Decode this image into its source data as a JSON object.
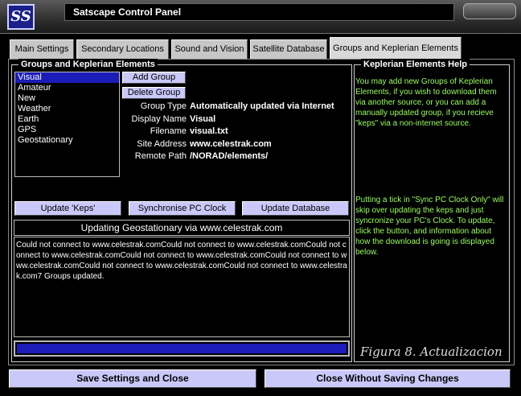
{
  "window": {
    "title": "Satscape Control Panel",
    "logo_text": "SS"
  },
  "tabs": [
    {
      "label": "Main Settings"
    },
    {
      "label": "Secondary Locations"
    },
    {
      "label": "Sound and Vision"
    },
    {
      "label": "Satellite Database"
    },
    {
      "label": "Groups and Keplerian Elements"
    }
  ],
  "groups_panel": {
    "legend": "Groups and Keplerian Elements",
    "list": [
      "Visual",
      "Amateur",
      "New",
      "Weather",
      "Earth",
      "GPS",
      "Geostationary"
    ],
    "selected": "Visual",
    "add_button": "Add Group",
    "delete_button": "Delete Group",
    "fields": [
      {
        "label": "Group Type",
        "value": "Automatically updated via Internet"
      },
      {
        "label": "Display Name",
        "value": "Visual"
      },
      {
        "label": "Filename",
        "value": "visual.txt"
      },
      {
        "label": "Site Address",
        "value": "www.celestrak.com"
      },
      {
        "label": "Remote Path",
        "value": "/NORAD/elements/"
      }
    ],
    "update_keps_button": "Update 'Keps'",
    "sync_clock_button": "Synchronise PC Clock",
    "update_db_button": "Update Database",
    "status_title": "Updating Geostationary via www.celestrak.com",
    "log_text": "Could not connect to www.celestrak.comCould not connect to www.celestrak.comCould not connect to www.celestrak.comCould not connect to www.celestrak.comCould not connect to www.celestrak.comCould not connect to www.celestrak.comCould not connect to www.celestrak.com7 Groups updated.",
    "progress": 1.0
  },
  "help_panel": {
    "legend": "Keplerian Elements Help",
    "paragraph1": "You may add new Groups of Keplerian Elements, if you wish to download them via another source, or you can add a manually updated group, if you recieve \"keps\" via a non-internet source.",
    "paragraph2": "Putting a tick in \"Sync PC Clock Only\" will skip over updating the keps and just syncronize your PC's Clock. To update, click the button, and information about how the download is going is displayed below.",
    "caption": "Figura 8. Actualizacion"
  },
  "footer": {
    "save_button": "Save Settings and Close",
    "close_button": "Close Without Saving Changes"
  },
  "colors": {
    "accent": "#c9c8f8",
    "selection": "#1c1cb8",
    "help_text": "#9bff5a"
  }
}
